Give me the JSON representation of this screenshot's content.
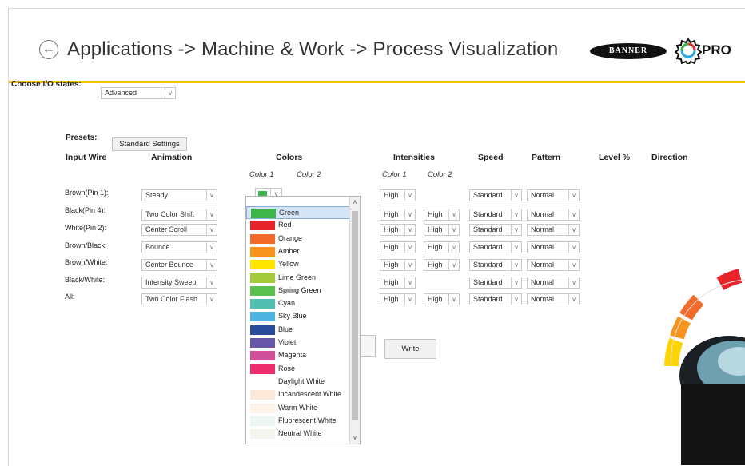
{
  "header": {
    "title": "Applications -> Machine & Work -> Process Visualization",
    "brand_logo": "BANNER",
    "pro_logo": "PRO"
  },
  "io_states": {
    "label": "Choose I/O states:",
    "value": "Advanced"
  },
  "presets": {
    "label": "Presets:",
    "button": "Standard Settings"
  },
  "columns": {
    "input_wire": "Input Wire",
    "animation": "Animation",
    "colors": "Colors",
    "intensities": "Intensities",
    "speed": "Speed",
    "pattern": "Pattern",
    "level": "Level %",
    "direction": "Direction"
  },
  "subheaders": {
    "color1": "Color 1",
    "color2": "Color 2",
    "intensity1": "Color 1",
    "intensity2": "Color 2"
  },
  "rows": [
    {
      "wire": "Brown(Pin 1):",
      "animation": "Steady",
      "intensity1": "High",
      "intensity2": "",
      "speed": "Standard",
      "pattern": "Normal"
    },
    {
      "wire": "Black(Pin 4):",
      "animation": "Two Color Shift",
      "intensity1": "High",
      "intensity2": "High",
      "speed": "Standard",
      "pattern": "Normal"
    },
    {
      "wire": "White(Pin 2):",
      "animation": "Center Scroll",
      "intensity1": "High",
      "intensity2": "High",
      "speed": "Standard",
      "pattern": "Normal"
    },
    {
      "wire": "Brown/Black:",
      "animation": "Bounce",
      "intensity1": "High",
      "intensity2": "High",
      "speed": "Standard",
      "pattern": "Normal"
    },
    {
      "wire": "Brown/White:",
      "animation": "Center Bounce",
      "intensity1": "High",
      "intensity2": "High",
      "speed": "Standard",
      "pattern": "Normal"
    },
    {
      "wire": "Black/White:",
      "animation": "Intensity Sweep",
      "intensity1": "High",
      "intensity2": "",
      "speed": "Standard",
      "pattern": "Normal"
    },
    {
      "wire": "All:",
      "animation": "Two Color Flash",
      "intensity1": "High",
      "intensity2": "High",
      "speed": "Standard",
      "pattern": "Normal"
    }
  ],
  "color1_current": "#3cb54a",
  "write_button": "Write",
  "color_options": [
    {
      "label": "Green",
      "swatch": "#3cb54a",
      "selected": true
    },
    {
      "label": "Red",
      "swatch": "#e8242b"
    },
    {
      "label": "Orange",
      "swatch": "#f26b2a"
    },
    {
      "label": "Amber",
      "swatch": "#f7941d"
    },
    {
      "label": "Yellow",
      "swatch": "#ffe500"
    },
    {
      "label": "Lime Green",
      "swatch": "#a4c93b"
    },
    {
      "label": "Spring Green",
      "swatch": "#5bbf4f"
    },
    {
      "label": "Cyan",
      "swatch": "#52bfb0"
    },
    {
      "label": "Sky Blue",
      "swatch": "#4fb4e2"
    },
    {
      "label": "Blue",
      "swatch": "#2a4a9c"
    },
    {
      "label": "Violet",
      "swatch": "#6757a8"
    },
    {
      "label": "Magenta",
      "swatch": "#d04f9a"
    },
    {
      "label": "Rose",
      "swatch": "#ed2c6d"
    },
    {
      "label": "Daylight White",
      "swatch": "#ffffff"
    },
    {
      "label": "Incandescent White",
      "swatch": "#fde9d9"
    },
    {
      "label": "Warm White",
      "swatch": "#fdf2e7"
    },
    {
      "label": "Fluorescent White",
      "swatch": "#eef5f5"
    },
    {
      "label": "Neutral White",
      "swatch": "#f5f5f0"
    }
  ]
}
